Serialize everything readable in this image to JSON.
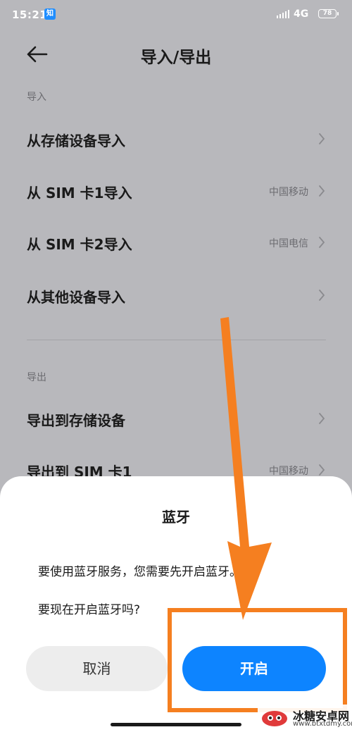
{
  "status_bar": {
    "time": "15:21",
    "app_badge": "知",
    "network": "4G",
    "battery": "78"
  },
  "header": {
    "title": "导入/导出",
    "back_icon": "arrow-left-icon"
  },
  "import_section": {
    "label": "导入",
    "items": [
      {
        "label": "从存储设备导入",
        "value": ""
      },
      {
        "label": "从 SIM 卡1导入",
        "value": "中国移动"
      },
      {
        "label": "从 SIM 卡2导入",
        "value": "中国电信"
      },
      {
        "label": "从其他设备导入",
        "value": ""
      }
    ]
  },
  "export_section": {
    "label": "导出",
    "items": [
      {
        "label": "导出到存储设备",
        "value": ""
      },
      {
        "label": "导出到 SIM 卡1",
        "value": "中国移动"
      }
    ]
  },
  "dialog": {
    "title": "蓝牙",
    "message_line1": "要使用蓝牙服务，您需要先开启蓝牙。",
    "message_line2": "要现在开启蓝牙吗?",
    "cancel_label": "取消",
    "confirm_label": "开启"
  },
  "watermark": {
    "name": "冰糖安卓网",
    "url": "www.btxtdmy.com"
  },
  "colors": {
    "accent": "#0d84ff",
    "annotation": "#f57f20",
    "scrim_background": "#b8b8bc"
  }
}
